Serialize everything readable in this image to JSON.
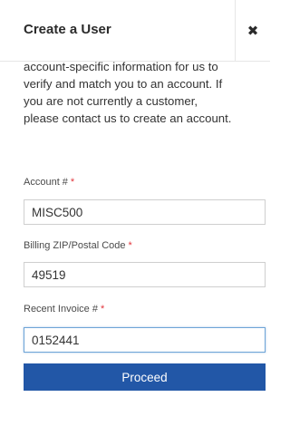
{
  "dialog": {
    "title": "Create a User",
    "close_symbol": "✖",
    "close_icon": "close-icon"
  },
  "intro": {
    "lines": [
      "account-specific information for us to",
      "verify and match you to an account. If",
      "you are not currently a customer,",
      "please contact us to create an account."
    ]
  },
  "form": {
    "required_marker": "*",
    "account": {
      "label": "Account #",
      "value": "MISC500"
    },
    "zip": {
      "label": "Billing ZIP/Postal Code",
      "value": "49519"
    },
    "invoice": {
      "label": "Recent Invoice #",
      "value": "0152441"
    },
    "submit_label": "Proceed"
  },
  "colors": {
    "primary_button": "#2257a7",
    "required": "#e2363c",
    "focus_border": "#6fa5d6"
  }
}
